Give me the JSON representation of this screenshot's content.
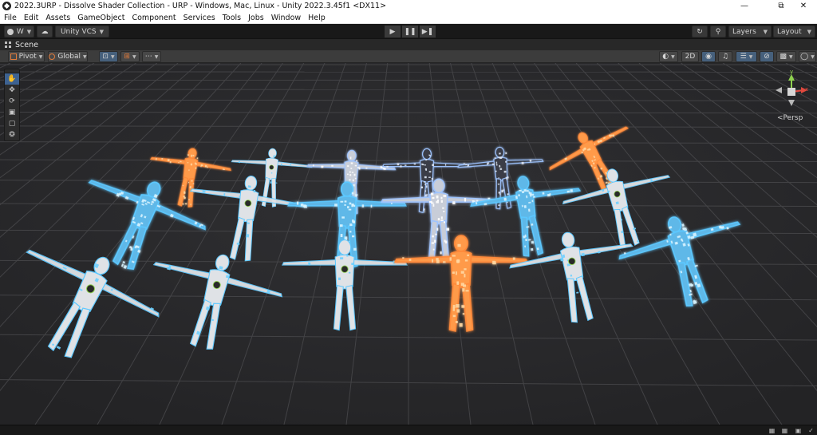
{
  "window": {
    "title": "2022.3URP - Dissolve Shader Collection - URP - Windows, Mac, Linux - Unity 2022.3.45f1 <DX11>",
    "controls": [
      "minimize-icon",
      "maximize-icon",
      "close-icon"
    ]
  },
  "menu": [
    "File",
    "Edit",
    "Assets",
    "GameObject",
    "Component",
    "Services",
    "Tools",
    "Jobs",
    "Window",
    "Help"
  ],
  "toolbar": {
    "account_label": "W",
    "vcs_label": "Unity VCS",
    "layers_label": "Layers",
    "layout_label": "Layout",
    "play_controls": [
      "play-icon",
      "pause-icon",
      "step-icon"
    ]
  },
  "scene_tab": {
    "label": "Scene"
  },
  "scene_toolbar": {
    "pivot_label": "Pivot",
    "global_label": "Global",
    "mode_2d_label": "2D"
  },
  "gizmo": {
    "projection_label": "Persp",
    "axis_y": "y",
    "axis_x": "x"
  },
  "tools": [
    "hand-tool-icon",
    "move-tool-icon",
    "rotate-tool-icon",
    "scale-tool-icon",
    "rect-tool-icon",
    "transform-tool-icon"
  ],
  "colors": {
    "accent_active": "#3d6291",
    "glow_cyan": "#5cc8ff",
    "glow_orange": "#ff8a3a",
    "glow_white": "#e8eef5",
    "axis_x": "#e0483e",
    "axis_y": "#8fd14f",
    "axis_z": "#4a8fe0"
  },
  "figures": [
    {
      "style": "dissolve-orange"
    },
    {
      "style": "robot-white"
    },
    {
      "style": "dissolve-white"
    },
    {
      "style": "dissolve-dark"
    },
    {
      "style": "dissolve-dark"
    },
    {
      "style": "dissolve-orange"
    },
    {
      "style": "dissolve-cyan"
    },
    {
      "style": "robot-white"
    },
    {
      "style": "dissolve-cyan"
    },
    {
      "style": "dissolve-white"
    },
    {
      "style": "dissolve-cyan"
    },
    {
      "style": "robot-white"
    },
    {
      "style": "robot-white"
    },
    {
      "style": "robot-white"
    },
    {
      "style": "robot-white"
    },
    {
      "style": "dissolve-orange"
    },
    {
      "style": "robot-white"
    },
    {
      "style": "dissolve-cyan"
    }
  ]
}
